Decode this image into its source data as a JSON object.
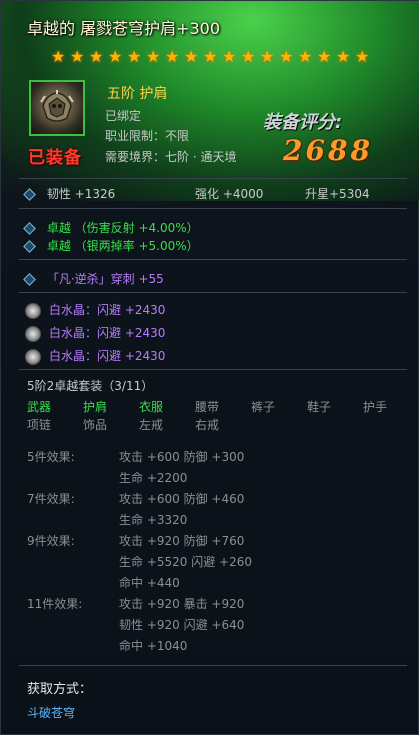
{
  "title": "卓越的 屠戮苍穹护肩+300",
  "stars": [
    "★",
    "★",
    "★",
    "★",
    "★",
    "★",
    "★",
    "★",
    "★",
    "★",
    "★",
    "★",
    "★",
    "★",
    "★",
    "★",
    "★"
  ],
  "equipped": "已装备",
  "grade": "五阶 护肩",
  "bound": "已绑定",
  "job_limit": "职业限制：不限",
  "realm": "需要境界：七阶 · 通天境",
  "score_label": "装备评分:",
  "score": "2688",
  "base": {
    "toughness": "韧性 +1326",
    "strengthen": "强化  +4000",
    "upstar": "升星+5304"
  },
  "excellent": [
    {
      "label": "卓越",
      "text": "（伤害反射 +4.00%）"
    },
    {
      "label": "卓越",
      "text": "（银两掉率 +5.00%）"
    }
  ],
  "special": "「凡·逆杀」穿刺 +55",
  "gems": [
    "白水晶：闪避 +2430",
    "白水晶：闪避 +2430",
    "白水晶：闪避 +2430"
  ],
  "suit_name": "5阶2卓越套装（3/11）",
  "suit_slots_row1": [
    {
      "name": "武器",
      "active": true
    },
    {
      "name": "护肩",
      "active": true
    },
    {
      "name": "衣服",
      "active": true
    },
    {
      "name": "腰带",
      "active": false
    },
    {
      "name": "裤子",
      "active": false
    },
    {
      "name": "鞋子",
      "active": false
    },
    {
      "name": "护手",
      "active": false
    }
  ],
  "suit_slots_row2": [
    {
      "name": "项链",
      "active": false
    },
    {
      "name": "饰品",
      "active": false
    },
    {
      "name": "左戒",
      "active": false
    },
    {
      "name": "右戒",
      "active": false
    }
  ],
  "effects": [
    {
      "label": "5件效果:",
      "lines": [
        "攻击 +600 防御 +300",
        "生命 +2200"
      ]
    },
    {
      "label": "7件效果:",
      "lines": [
        "攻击 +600 防御 +460",
        "生命 +3320"
      ]
    },
    {
      "label": "9件效果:",
      "lines": [
        "攻击 +920 防御 +760",
        "生命 +5520 闪避 +260",
        "命中 +440"
      ]
    },
    {
      "label": "11件效果:",
      "lines": [
        "攻击 +920 暴击 +920",
        "韧性 +920 闪避 +640",
        "命中 +1040"
      ]
    }
  ],
  "obtain_title": "获取方式：",
  "obtain_link": "斗破苍穹"
}
